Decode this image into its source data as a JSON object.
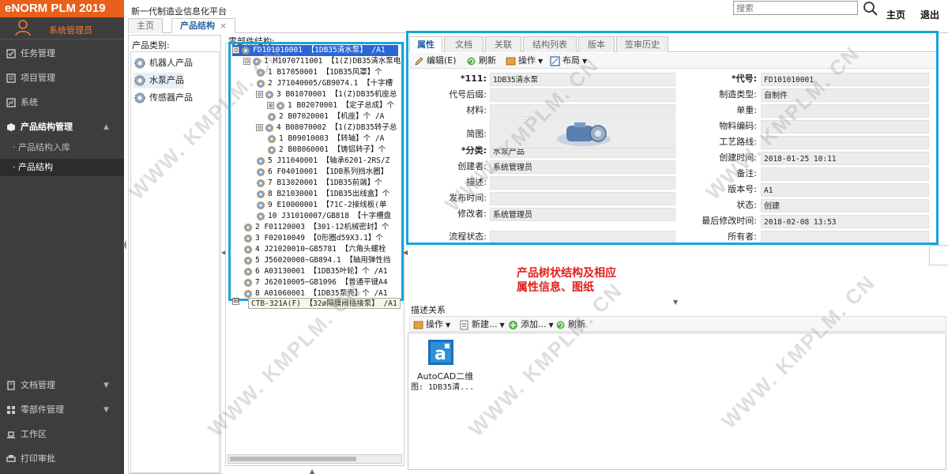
{
  "app": {
    "brand": "eNORM PLM 2019",
    "platform_title": "新一代制造业信息化平台",
    "search_placeholder": "搜索",
    "home_link": "主页",
    "logout_link": "退出"
  },
  "sidebar": {
    "user": "系统管理员",
    "items": [
      {
        "label": "任务管理"
      },
      {
        "label": "项目管理"
      },
      {
        "label": "系统"
      },
      {
        "label": "产品结构管理"
      }
    ],
    "subitems": [
      {
        "label": "产品结构入库"
      },
      {
        "label": "产品结构"
      }
    ],
    "bottom_items": [
      {
        "label": "文档管理"
      },
      {
        "label": "零部件管理"
      },
      {
        "label": "工作区"
      },
      {
        "label": "打印审批"
      }
    ]
  },
  "tabs": [
    {
      "label": "主页"
    },
    {
      "label": "产品结构",
      "close": "×"
    }
  ],
  "category": {
    "label": "产品类别:",
    "items": [
      {
        "label": "机器人产品"
      },
      {
        "label": "水泵产品"
      },
      {
        "label": "传感器产品"
      }
    ]
  },
  "tree": {
    "label": "零部件结构:",
    "rows": [
      {
        "toggle": "⊟",
        "text": "FD101010001 【1DB35清水泵】 /A1"
      },
      {
        "toggle": "⊟",
        "text": "1 M1070711001 【1(Z)DB35清水泵电"
      },
      {
        "toggle": "",
        "text": "1 B17050001 【1DB35风罩】个"
      },
      {
        "toggle": "",
        "text": "2 J71040005/GB9074.1 【十字槽"
      },
      {
        "toggle": "⊟",
        "text": "3 B01070001 【1(Z)DB35机座总"
      },
      {
        "toggle": "⊞",
        "text": "1 B02070001 【定子总成】个"
      },
      {
        "toggle": "",
        "text": "2 B07020001 【机座】个 /A"
      },
      {
        "toggle": "⊟",
        "text": "4 B08070002 【1(Z)DB35转子总"
      },
      {
        "toggle": "",
        "text": "1 B09010003 【转轴】个 /A"
      },
      {
        "toggle": "",
        "text": "2 B08060001 【铸铝转子】个"
      },
      {
        "toggle": "",
        "text": "5 J11040001 【轴承6201-2RS/Z"
      },
      {
        "toggle": "",
        "text": "6 F04010001 【1DB系列挡水圈】"
      },
      {
        "toggle": "",
        "text": "7 B13020001 【1DB35前端】个"
      },
      {
        "toggle": "",
        "text": "8 B21030001 【1DB35出线盒】个"
      },
      {
        "toggle": "",
        "text": "9 E10000001 【71C-2接线板(单"
      },
      {
        "toggle": "",
        "text": "10 J31010007/GB818 【十字槽盘"
      },
      {
        "toggle": "",
        "text": "2 F01120003 【301-12机械密封】个"
      },
      {
        "toggle": "",
        "text": "3 F02010049 【O形圈d59X3.1】个"
      },
      {
        "toggle": "",
        "text": "4 J21020010~GB5781 【六角头螺栓"
      },
      {
        "toggle": "",
        "text": "5 J56020008~GB894.1 【轴用弹性挡"
      },
      {
        "toggle": "",
        "text": "6 A03130001 【1DB35叶轮】个 /A1"
      },
      {
        "toggle": "",
        "text": "7 J62010005~GB1096 【普通平键A4"
      },
      {
        "toggle": "",
        "text": "8 A01060001 【1DB35泵壳】个 /A1"
      }
    ],
    "tooltip": "CTB-321A(F) 【32ø隔膜阀插接泵】 /A1",
    "last_toggle": "⊞"
  },
  "props": {
    "tabs": [
      {
        "label": "属性"
      },
      {
        "label": "文档"
      },
      {
        "label": "关联"
      },
      {
        "label": "结构列表"
      },
      {
        "label": "版本"
      },
      {
        "label": "签审历史"
      }
    ],
    "toolbar": {
      "edit": "编辑(E)",
      "refresh": "刷新",
      "operate": "操作",
      "layout": "布局"
    },
    "left_fields": [
      {
        "label": "*111:",
        "value": "1DB35清水泵"
      },
      {
        "label": "代号后缀:",
        "value": ""
      },
      {
        "label": "材料:",
        "value": ""
      },
      {
        "label": "简图:",
        "value": ""
      },
      {
        "label": "*分类:",
        "value": "水泵产品"
      },
      {
        "label": "创建者:",
        "value": "系统管理员"
      },
      {
        "label": "描述:",
        "value": ""
      },
      {
        "label": "发布时间:",
        "value": ""
      },
      {
        "label": "修改者:",
        "value": "系统管理员"
      },
      {
        "label": "流程状态:",
        "value": ""
      }
    ],
    "right_fields": [
      {
        "label": "*代号:",
        "value": "FD101010001"
      },
      {
        "label": "制造类型:",
        "value": "自制件"
      },
      {
        "label": "单重:",
        "value": ""
      },
      {
        "label": "物料编码:",
        "value": ""
      },
      {
        "label": "工艺路线:",
        "value": ""
      },
      {
        "label": "创建时间:",
        "value": "2018-01-25 10:11"
      },
      {
        "label": "备注:",
        "value": ""
      },
      {
        "label": "版本号:",
        "value": "A1"
      },
      {
        "label": "状态:",
        "value": "创建"
      },
      {
        "label": "最后修改时间:",
        "value": "2018-02-08 13:53"
      },
      {
        "label": "所有者:",
        "value": ""
      }
    ]
  },
  "annotation": {
    "line1": "产品树状结构及相应",
    "line2": "属性信息、图纸"
  },
  "relations": {
    "title": "描述关系",
    "toolbar": {
      "operate": "操作",
      "new": "新建...",
      "add": "添加...",
      "refresh": "刷新"
    },
    "file": {
      "name_line1": "AutoCAD二维",
      "name_line2": "图: 1DB35清..."
    }
  },
  "watermark": "WWW. KMPLM. CN",
  "colors": {
    "brand_orange": "#e8601c",
    "sidebar_bg": "#3d3d3d",
    "highlight_blue": "#17a5dc",
    "selected_row": "#2a66d6",
    "annotation_red": "#e0201c"
  }
}
